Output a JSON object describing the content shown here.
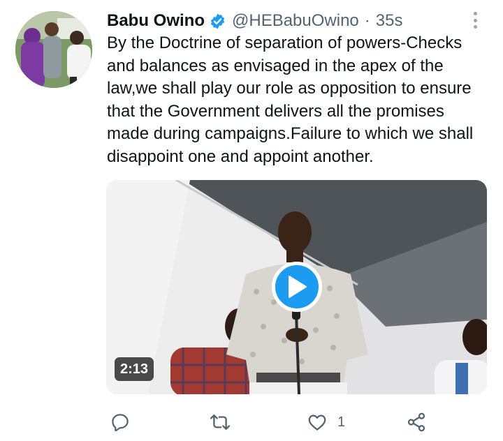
{
  "author": {
    "name": "Babu Owino",
    "handle": "@HEBabuOwino",
    "separator": "·",
    "time": "35s",
    "verified_color": "#1d9bf0"
  },
  "tweet": {
    "text": "By the Doctrine of separation of powers-Checks\nand balances as envisaged in the apex of the\nlaw,we shall play our role as opposition to ensure\nthat the Government delivers all the promises\nmade during campaigns.Failure to which we shall\ndisappoint one and appoint another."
  },
  "media": {
    "type": "video",
    "duration": "2:13",
    "play_icon": "play-icon"
  },
  "actions": {
    "reply": {
      "icon": "reply-icon",
      "count": ""
    },
    "retweet": {
      "icon": "retweet-icon",
      "count": ""
    },
    "like": {
      "icon": "heart-icon",
      "count": "1"
    },
    "share": {
      "icon": "share-icon",
      "count": ""
    }
  },
  "colors": {
    "text_primary": "#0f1419",
    "text_secondary": "#536471",
    "accent": "#1d9bf0"
  }
}
